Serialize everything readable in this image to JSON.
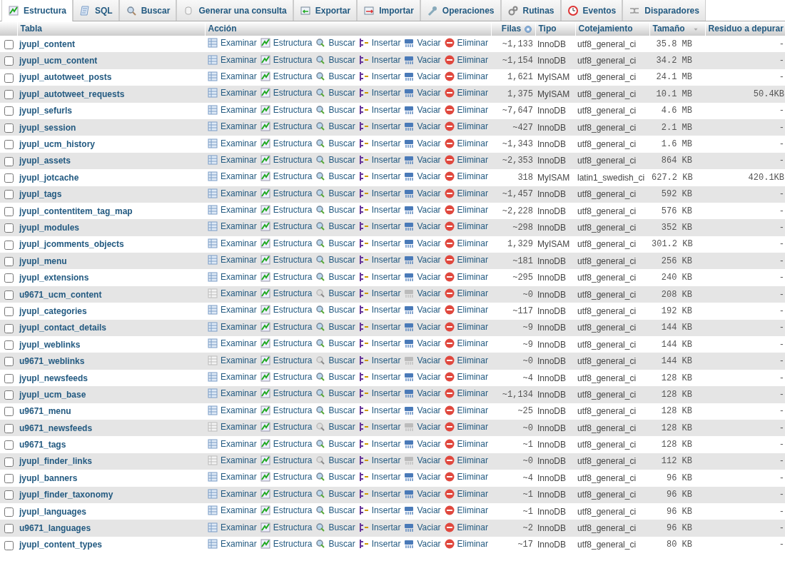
{
  "tabs": [
    {
      "label": "Estructura",
      "selected": true
    },
    {
      "label": "SQL",
      "selected": false
    },
    {
      "label": "Buscar",
      "selected": false
    },
    {
      "label": "Generar una consulta",
      "selected": false
    },
    {
      "label": "Exportar",
      "selected": false
    },
    {
      "label": "Importar",
      "selected": false
    },
    {
      "label": "Operaciones",
      "selected": false
    },
    {
      "label": "Rutinas",
      "selected": false
    },
    {
      "label": "Eventos",
      "selected": false
    },
    {
      "label": "Disparadores",
      "selected": false
    }
  ],
  "table": {
    "columns": [
      "Tabla",
      "Acción",
      "Filas",
      "Tipo",
      "Cotejamiento",
      "Tamaño",
      "Residuo a depurar"
    ],
    "rows": [
      {
        "name": "jyupl_content",
        "checked": false,
        "empty": false,
        "actions": [
          "Examinar",
          "Estructura",
          "Buscar",
          "Insertar",
          "Vaciar",
          "Eliminar"
        ],
        "rows": "~1,133",
        "type": "InnoDB",
        "collation": "utf8_general_ci",
        "size": "35.8 MB",
        "overhead": "-"
      },
      {
        "name": "jyupl_ucm_content",
        "checked": false,
        "empty": false,
        "actions": [
          "Examinar",
          "Estructura",
          "Buscar",
          "Insertar",
          "Vaciar",
          "Eliminar"
        ],
        "rows": "~1,154",
        "type": "InnoDB",
        "collation": "utf8_general_ci",
        "size": "34.2 MB",
        "overhead": "-"
      },
      {
        "name": "jyupl_autotweet_posts",
        "checked": false,
        "empty": false,
        "actions": [
          "Examinar",
          "Estructura",
          "Buscar",
          "Insertar",
          "Vaciar",
          "Eliminar"
        ],
        "rows": "1,621",
        "type": "MyISAM",
        "collation": "utf8_general_ci",
        "size": "24.1 MB",
        "overhead": "-"
      },
      {
        "name": "jyupl_autotweet_requests",
        "checked": false,
        "empty": false,
        "actions": [
          "Examinar",
          "Estructura",
          "Buscar",
          "Insertar",
          "Vaciar",
          "Eliminar"
        ],
        "rows": "1,375",
        "type": "MyISAM",
        "collation": "utf8_general_ci",
        "size": "10.1 MB",
        "overhead": "50.4KB"
      },
      {
        "name": "jyupl_sefurls",
        "checked": false,
        "empty": false,
        "actions": [
          "Examinar",
          "Estructura",
          "Buscar",
          "Insertar",
          "Vaciar",
          "Eliminar"
        ],
        "rows": "~7,647",
        "type": "InnoDB",
        "collation": "utf8_general_ci",
        "size": "4.6 MB",
        "overhead": "-"
      },
      {
        "name": "jyupl_session",
        "checked": false,
        "empty": false,
        "actions": [
          "Examinar",
          "Estructura",
          "Buscar",
          "Insertar",
          "Vaciar",
          "Eliminar"
        ],
        "rows": "~427",
        "type": "InnoDB",
        "collation": "utf8_general_ci",
        "size": "2.1 MB",
        "overhead": "-"
      },
      {
        "name": "jyupl_ucm_history",
        "checked": false,
        "empty": false,
        "actions": [
          "Examinar",
          "Estructura",
          "Buscar",
          "Insertar",
          "Vaciar",
          "Eliminar"
        ],
        "rows": "~1,343",
        "type": "InnoDB",
        "collation": "utf8_general_ci",
        "size": "1.6 MB",
        "overhead": "-"
      },
      {
        "name": "jyupl_assets",
        "checked": false,
        "empty": false,
        "actions": [
          "Examinar",
          "Estructura",
          "Buscar",
          "Insertar",
          "Vaciar",
          "Eliminar"
        ],
        "rows": "~2,353",
        "type": "InnoDB",
        "collation": "utf8_general_ci",
        "size": "864 KB",
        "overhead": "-"
      },
      {
        "name": "jyupl_jotcache",
        "checked": false,
        "empty": false,
        "actions": [
          "Examinar",
          "Estructura",
          "Buscar",
          "Insertar",
          "Vaciar",
          "Eliminar"
        ],
        "rows": "318",
        "type": "MyISAM",
        "collation": "latin1_swedish_ci",
        "size": "627.2 KB",
        "overhead": "420.1KB"
      },
      {
        "name": "jyupl_tags",
        "checked": false,
        "empty": false,
        "actions": [
          "Examinar",
          "Estructura",
          "Buscar",
          "Insertar",
          "Vaciar",
          "Eliminar"
        ],
        "rows": "~1,457",
        "type": "InnoDB",
        "collation": "utf8_general_ci",
        "size": "592 KB",
        "overhead": "-"
      },
      {
        "name": "jyupl_contentitem_tag_map",
        "checked": false,
        "empty": false,
        "actions": [
          "Examinar",
          "Estructura",
          "Buscar",
          "Insertar",
          "Vaciar",
          "Eliminar"
        ],
        "rows": "~2,228",
        "type": "InnoDB",
        "collation": "utf8_general_ci",
        "size": "576 KB",
        "overhead": "-"
      },
      {
        "name": "jyupl_modules",
        "checked": false,
        "empty": false,
        "actions": [
          "Examinar",
          "Estructura",
          "Buscar",
          "Insertar",
          "Vaciar",
          "Eliminar"
        ],
        "rows": "~298",
        "type": "InnoDB",
        "collation": "utf8_general_ci",
        "size": "352 KB",
        "overhead": "-"
      },
      {
        "name": "jyupl_jcomments_objects",
        "checked": false,
        "empty": false,
        "actions": [
          "Examinar",
          "Estructura",
          "Buscar",
          "Insertar",
          "Vaciar",
          "Eliminar"
        ],
        "rows": "1,329",
        "type": "MyISAM",
        "collation": "utf8_general_ci",
        "size": "301.2 KB",
        "overhead": "-"
      },
      {
        "name": "jyupl_menu",
        "checked": false,
        "empty": false,
        "actions": [
          "Examinar",
          "Estructura",
          "Buscar",
          "Insertar",
          "Vaciar",
          "Eliminar"
        ],
        "rows": "~181",
        "type": "InnoDB",
        "collation": "utf8_general_ci",
        "size": "256 KB",
        "overhead": "-"
      },
      {
        "name": "jyupl_extensions",
        "checked": false,
        "empty": false,
        "actions": [
          "Examinar",
          "Estructura",
          "Buscar",
          "Insertar",
          "Vaciar",
          "Eliminar"
        ],
        "rows": "~295",
        "type": "InnoDB",
        "collation": "utf8_general_ci",
        "size": "240 KB",
        "overhead": "-"
      },
      {
        "name": "u9671_ucm_content",
        "checked": false,
        "empty": true,
        "actions": [
          "Examinar",
          "Estructura",
          "Buscar",
          "Insertar",
          "Vaciar",
          "Eliminar"
        ],
        "rows": "~0",
        "type": "InnoDB",
        "collation": "utf8_general_ci",
        "size": "208 KB",
        "overhead": "-"
      },
      {
        "name": "jyupl_categories",
        "checked": false,
        "empty": false,
        "actions": [
          "Examinar",
          "Estructura",
          "Buscar",
          "Insertar",
          "Vaciar",
          "Eliminar"
        ],
        "rows": "~117",
        "type": "InnoDB",
        "collation": "utf8_general_ci",
        "size": "192 KB",
        "overhead": "-"
      },
      {
        "name": "jyupl_contact_details",
        "checked": false,
        "empty": false,
        "actions": [
          "Examinar",
          "Estructura",
          "Buscar",
          "Insertar",
          "Vaciar",
          "Eliminar"
        ],
        "rows": "~9",
        "type": "InnoDB",
        "collation": "utf8_general_ci",
        "size": "144 KB",
        "overhead": "-"
      },
      {
        "name": "jyupl_weblinks",
        "checked": false,
        "empty": false,
        "actions": [
          "Examinar",
          "Estructura",
          "Buscar",
          "Insertar",
          "Vaciar",
          "Eliminar"
        ],
        "rows": "~9",
        "type": "InnoDB",
        "collation": "utf8_general_ci",
        "size": "144 KB",
        "overhead": "-"
      },
      {
        "name": "u9671_weblinks",
        "checked": false,
        "empty": true,
        "actions": [
          "Examinar",
          "Estructura",
          "Buscar",
          "Insertar",
          "Vaciar",
          "Eliminar"
        ],
        "rows": "~0",
        "type": "InnoDB",
        "collation": "utf8_general_ci",
        "size": "144 KB",
        "overhead": "-"
      },
      {
        "name": "jyupl_newsfeeds",
        "checked": false,
        "empty": false,
        "actions": [
          "Examinar",
          "Estructura",
          "Buscar",
          "Insertar",
          "Vaciar",
          "Eliminar"
        ],
        "rows": "~4",
        "type": "InnoDB",
        "collation": "utf8_general_ci",
        "size": "128 KB",
        "overhead": "-"
      },
      {
        "name": "jyupl_ucm_base",
        "checked": false,
        "empty": false,
        "actions": [
          "Examinar",
          "Estructura",
          "Buscar",
          "Insertar",
          "Vaciar",
          "Eliminar"
        ],
        "rows": "~1,134",
        "type": "InnoDB",
        "collation": "utf8_general_ci",
        "size": "128 KB",
        "overhead": "-"
      },
      {
        "name": "u9671_menu",
        "checked": false,
        "empty": false,
        "actions": [
          "Examinar",
          "Estructura",
          "Buscar",
          "Insertar",
          "Vaciar",
          "Eliminar"
        ],
        "rows": "~25",
        "type": "InnoDB",
        "collation": "utf8_general_ci",
        "size": "128 KB",
        "overhead": "-"
      },
      {
        "name": "u9671_newsfeeds",
        "checked": false,
        "empty": true,
        "actions": [
          "Examinar",
          "Estructura",
          "Buscar",
          "Insertar",
          "Vaciar",
          "Eliminar"
        ],
        "rows": "~0",
        "type": "InnoDB",
        "collation": "utf8_general_ci",
        "size": "128 KB",
        "overhead": "-"
      },
      {
        "name": "u9671_tags",
        "checked": false,
        "empty": false,
        "actions": [
          "Examinar",
          "Estructura",
          "Buscar",
          "Insertar",
          "Vaciar",
          "Eliminar"
        ],
        "rows": "~1",
        "type": "InnoDB",
        "collation": "utf8_general_ci",
        "size": "128 KB",
        "overhead": "-"
      },
      {
        "name": "jyupl_finder_links",
        "checked": false,
        "empty": true,
        "actions": [
          "Examinar",
          "Estructura",
          "Buscar",
          "Insertar",
          "Vaciar",
          "Eliminar"
        ],
        "rows": "~0",
        "type": "InnoDB",
        "collation": "utf8_general_ci",
        "size": "112 KB",
        "overhead": "-"
      },
      {
        "name": "jyupl_banners",
        "checked": false,
        "empty": false,
        "actions": [
          "Examinar",
          "Estructura",
          "Buscar",
          "Insertar",
          "Vaciar",
          "Eliminar"
        ],
        "rows": "~4",
        "type": "InnoDB",
        "collation": "utf8_general_ci",
        "size": "96 KB",
        "overhead": "-"
      },
      {
        "name": "jyupl_finder_taxonomy",
        "checked": false,
        "empty": false,
        "actions": [
          "Examinar",
          "Estructura",
          "Buscar",
          "Insertar",
          "Vaciar",
          "Eliminar"
        ],
        "rows": "~1",
        "type": "InnoDB",
        "collation": "utf8_general_ci",
        "size": "96 KB",
        "overhead": "-"
      },
      {
        "name": "jyupl_languages",
        "checked": false,
        "empty": false,
        "actions": [
          "Examinar",
          "Estructura",
          "Buscar",
          "Insertar",
          "Vaciar",
          "Eliminar"
        ],
        "rows": "~1",
        "type": "InnoDB",
        "collation": "utf8_general_ci",
        "size": "96 KB",
        "overhead": "-"
      },
      {
        "name": "u9671_languages",
        "checked": false,
        "empty": false,
        "actions": [
          "Examinar",
          "Estructura",
          "Buscar",
          "Insertar",
          "Vaciar",
          "Eliminar"
        ],
        "rows": "~2",
        "type": "InnoDB",
        "collation": "utf8_general_ci",
        "size": "96 KB",
        "overhead": "-"
      },
      {
        "name": "jyupl_content_types",
        "checked": false,
        "empty": false,
        "actions": [
          "Examinar",
          "Estructura",
          "Buscar",
          "Insertar",
          "Vaciar",
          "Eliminar"
        ],
        "rows": "~17",
        "type": "InnoDB",
        "collation": "utf8_general_ci",
        "size": "80 KB",
        "overhead": "-"
      }
    ]
  }
}
